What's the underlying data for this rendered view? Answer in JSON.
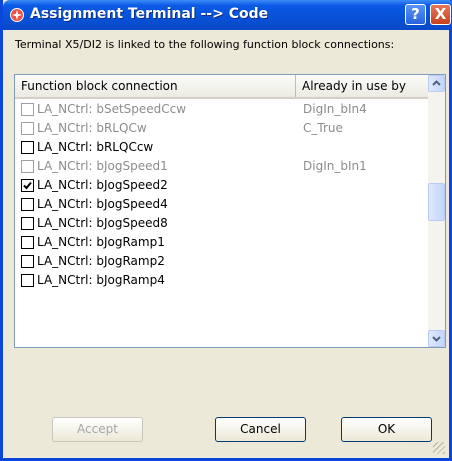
{
  "window": {
    "title": "Assignment Terminal --> Code",
    "help_label": "?",
    "close_label": "X"
  },
  "description": "Terminal X5/DI2 is linked to the following function block connections:",
  "columns": [
    "Function block connection",
    "Already in use by"
  ],
  "rows": [
    {
      "name": "LA_NCtrl: bSetSpeedCcw",
      "in_use_by": "DigIn_bIn4",
      "checked": false,
      "disabled": true
    },
    {
      "name": "LA_NCtrl: bRLQCw",
      "in_use_by": "C_True",
      "checked": false,
      "disabled": true
    },
    {
      "name": "LA_NCtrl: bRLQCcw",
      "in_use_by": "",
      "checked": false,
      "disabled": false
    },
    {
      "name": "LA_NCtrl: bJogSpeed1",
      "in_use_by": "DigIn_bIn1",
      "checked": false,
      "disabled": true
    },
    {
      "name": "LA_NCtrl: bJogSpeed2",
      "in_use_by": "",
      "checked": true,
      "disabled": false
    },
    {
      "name": "LA_NCtrl: bJogSpeed4",
      "in_use_by": "",
      "checked": false,
      "disabled": false
    },
    {
      "name": "LA_NCtrl: bJogSpeed8",
      "in_use_by": "",
      "checked": false,
      "disabled": false
    },
    {
      "name": "LA_NCtrl: bJogRamp1",
      "in_use_by": "",
      "checked": false,
      "disabled": false
    },
    {
      "name": "LA_NCtrl: bJogRamp2",
      "in_use_by": "",
      "checked": false,
      "disabled": false
    },
    {
      "name": "LA_NCtrl: bJogRamp4",
      "in_use_by": "",
      "checked": false,
      "disabled": false
    }
  ],
  "scrollbar": {
    "up_icon": "scroll-up-arrow",
    "down_icon": "scroll-down-arrow"
  },
  "buttons": {
    "accept": "Accept",
    "cancel": "Cancel",
    "ok": "OK"
  },
  "colors": {
    "titlebar": "#0a5ae6",
    "disabled_text": "#8c8c8c",
    "dialog_bg": "#ece9d8"
  }
}
